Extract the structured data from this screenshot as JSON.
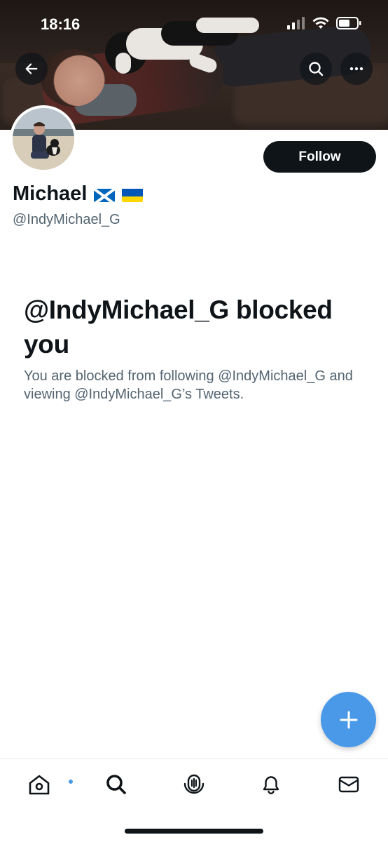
{
  "status_bar": {
    "time": "18:16"
  },
  "header": {
    "back_icon": "arrow-left-icon",
    "search_icon": "search-icon",
    "more_icon": "more-horizontal-icon"
  },
  "profile": {
    "display_name": "Michael",
    "flags": [
      "scotland-flag",
      "ukraine-flag"
    ],
    "handle": "@IndyMichael_G",
    "follow_label": "Follow"
  },
  "blocked": {
    "title": "@IndyMichael_G blocked you",
    "description": "You are blocked from following @IndyMichael_G and viewing @IndyMichael_G’s Tweets."
  },
  "fab": {
    "icon": "plus-icon"
  },
  "tabbar": {
    "items": [
      {
        "name": "home",
        "icon": "home-icon",
        "has_notification_dot": true
      },
      {
        "name": "search",
        "icon": "search-icon"
      },
      {
        "name": "spaces",
        "icon": "spaces-icon"
      },
      {
        "name": "notifications",
        "icon": "bell-icon"
      },
      {
        "name": "messages",
        "icon": "mail-icon"
      }
    ]
  },
  "colors": {
    "accent": "#4a99e9",
    "text_primary": "#0f1419",
    "text_secondary": "#536471",
    "follow_button_bg": "#0f1419"
  }
}
